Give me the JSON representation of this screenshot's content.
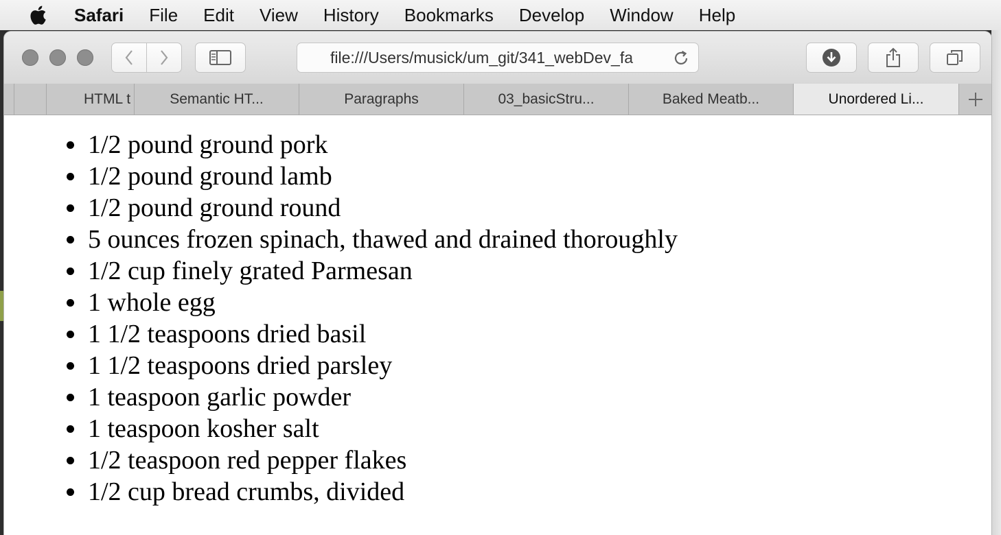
{
  "menubar": {
    "app_name": "Safari",
    "items": [
      "File",
      "Edit",
      "View",
      "History",
      "Bookmarks",
      "Develop",
      "Window",
      "Help"
    ]
  },
  "toolbar": {
    "address_url": "file:///Users/musick/um_git/341_webDev_fa",
    "icons": {
      "back": "chevron-left-icon",
      "forward": "chevron-right-icon",
      "sidebar": "sidebar-icon",
      "reload": "reload-icon",
      "downloads": "download-icon",
      "share": "share-icon",
      "tabs_overview": "tabs-overview-icon"
    }
  },
  "tabs": [
    {
      "label": "HTML t"
    },
    {
      "label": "Semantic HT..."
    },
    {
      "label": "Paragraphs"
    },
    {
      "label": "03_basicStru..."
    },
    {
      "label": "Baked Meatb..."
    },
    {
      "label": "Unordered Li...",
      "active": true
    }
  ],
  "page": {
    "ingredients": [
      "1/2 pound ground pork",
      "1/2 pound ground lamb",
      "1/2 pound ground round",
      "5 ounces frozen spinach, thawed and drained thoroughly",
      "1/2 cup finely grated Parmesan",
      "1 whole egg",
      "1 1/2 teaspoons dried basil",
      "1 1/2 teaspoons dried parsley",
      "1 teaspoon garlic powder",
      "1 teaspoon kosher salt",
      "1/2 teaspoon red pepper flakes",
      "1/2 cup bread crumbs, divided"
    ]
  },
  "colors": {
    "menubar_bg": "#eeeeee",
    "toolbar_bg": "#e2e2e2",
    "tabbar_bg": "#c8c8c8",
    "active_tab_bg": "#e9e9e9",
    "content_bg": "#ffffff",
    "text": "#000000"
  }
}
